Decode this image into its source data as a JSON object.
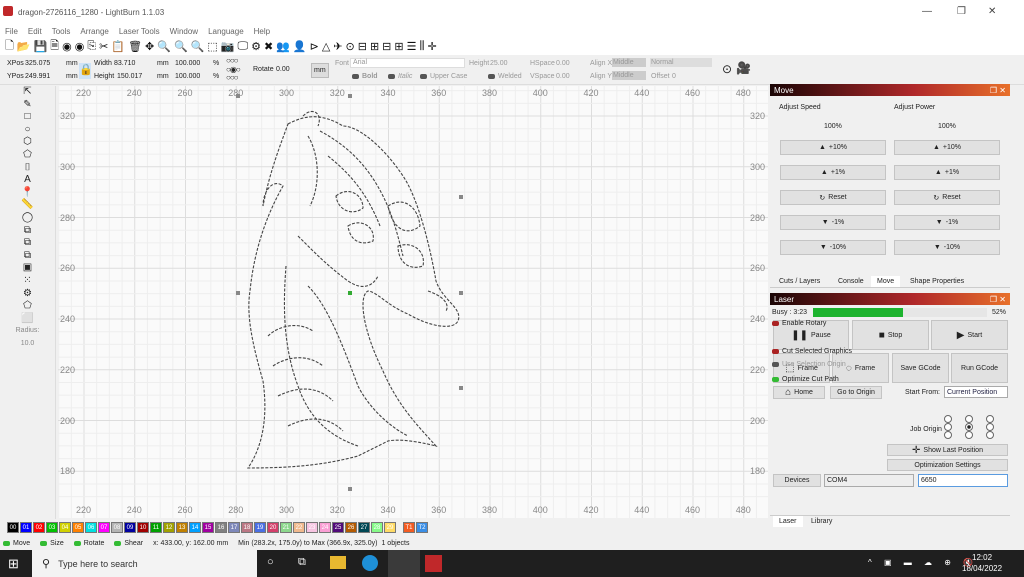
{
  "window": {
    "title": "dragon-2726116_1280 - LightBurn 1.1.03",
    "minimize": "—",
    "maximize": "❐",
    "close": "✕"
  },
  "menu": [
    "File",
    "Edit",
    "Tools",
    "Arrange",
    "Laser Tools",
    "Window",
    "Language",
    "Help"
  ],
  "toolbar_icons": [
    "new-file",
    "open-folder",
    "save",
    "save-as",
    "import",
    "export",
    "copy",
    "cut",
    "paste",
    "delete",
    "move",
    "zoom-in",
    "zoom-in-2",
    "zoom-out",
    "zoom-frame",
    "camera",
    "monitor",
    "settings",
    "tools",
    "group",
    "user",
    "mirror",
    "flip",
    "send",
    "target",
    "align-h",
    "align-v",
    "distribute-h",
    "distribute-v",
    "align-rows",
    "align-cols",
    "center"
  ],
  "props": {
    "xpos_label": "XPos",
    "xpos": "325.075",
    "ypos_label": "YPos",
    "ypos": "249.991",
    "unit": "mm",
    "width_label": "Width",
    "width": "83.710",
    "height_label": "Height",
    "height": "150.017",
    "scale_w": "100.000",
    "scale_h": "100.000",
    "pct": "%",
    "rotate_label": "Rotate",
    "rotate": "0.00",
    "mm_button": "mm",
    "font_label": "Font",
    "font": "Arial",
    "text_height_label": "Height",
    "text_height": "25.00",
    "hspace_label": "HSpace",
    "hspace": "0.00",
    "vspace_label": "VSpace",
    "vspace": "0.00",
    "alignx_label": "Align X",
    "alignx": "Middle",
    "aligny_label": "Align Y",
    "aligny": "Middle",
    "normal": "Normal",
    "offset_label": "Offset",
    "offset": "0",
    "bold": "Bold",
    "italic": "Italic",
    "upper": "Upper Case",
    "welded": "Welded"
  },
  "left_tools": {
    "icons": [
      "select",
      "pencil",
      "rectangle",
      "ellipse",
      "polygon",
      "polygon-2",
      "frame-tool",
      "text",
      "position-pin",
      "measure",
      "offset",
      "boolean-union",
      "boolean-subtract",
      "boolean-intersect",
      "boolean-weld",
      "array-grid",
      "array-circular",
      "corner-round",
      "corner-chamfer"
    ],
    "radius_label": "Radius:",
    "radius": "10.0"
  },
  "canvas": {
    "x_ticks": [
      "220",
      "240",
      "260",
      "280",
      "300",
      "320",
      "340",
      "360",
      "380",
      "400",
      "420",
      "440",
      "460",
      "480"
    ],
    "y_ticks": [
      "320",
      "300",
      "280",
      "260",
      "240",
      "220",
      "200",
      "180"
    ]
  },
  "move_panel": {
    "title": "Move",
    "speed_label": "Adjust Speed",
    "power_label": "Adjust Power",
    "speed_value": "100%",
    "power_value": "100%",
    "buttons": [
      "+10%",
      "+1%",
      "Reset",
      "-1%",
      "-10%"
    ]
  },
  "tabs_top": [
    "Cuts / Layers",
    "Console",
    "Move",
    "Shape Properties"
  ],
  "tabs_top_active": "Move",
  "laser_panel": {
    "title": "Laser",
    "busy": "Busy : 3:23",
    "progress_percent": 52,
    "progress_label": "52%",
    "progress_color": "#1db32e",
    "pause": "Pause",
    "stop": "Stop",
    "start": "Start",
    "frame1": "Frame",
    "frame2": "Frame",
    "save_gcode": "Save GCode",
    "run_gcode": "Run GCode",
    "home": "Home",
    "go_origin": "Go to Origin",
    "start_from_label": "Start From:",
    "start_from": "Current Position",
    "enable_rotary": "Enable Rotary",
    "cut_selected": "Cut Selected Graphics",
    "use_selection_origin": "Use Selection Origin",
    "optimize_cut": "Optimize Cut Path",
    "job_origin_label": "Job Origin",
    "show_last": "Show Last Position",
    "opt_settings": "Optimization Settings",
    "devices": "Devices",
    "port": "COM4",
    "device": "6650"
  },
  "tabs_bottom": [
    "Laser",
    "Library"
  ],
  "palette": [
    {
      "l": "00",
      "c": "#000000"
    },
    {
      "l": "01",
      "c": "#0000ff"
    },
    {
      "l": "02",
      "c": "#ff0000"
    },
    {
      "l": "03",
      "c": "#00c000"
    },
    {
      "l": "04",
      "c": "#d0d000"
    },
    {
      "l": "05",
      "c": "#ff8000"
    },
    {
      "l": "06",
      "c": "#00e0e0"
    },
    {
      "l": "07",
      "c": "#ff00ff"
    },
    {
      "l": "08",
      "c": "#b4b4b4"
    },
    {
      "l": "09",
      "c": "#0000a0"
    },
    {
      "l": "10",
      "c": "#a00000"
    },
    {
      "l": "11",
      "c": "#00a000"
    },
    {
      "l": "12",
      "c": "#a0a000"
    },
    {
      "l": "13",
      "c": "#c08000"
    },
    {
      "l": "14",
      "c": "#00a0ff"
    },
    {
      "l": "15",
      "c": "#a000a0"
    },
    {
      "l": "16",
      "c": "#808080"
    },
    {
      "l": "17",
      "c": "#7d87b9"
    },
    {
      "l": "18",
      "c": "#bb7784"
    },
    {
      "l": "19",
      "c": "#4a6fe3"
    },
    {
      "l": "20",
      "c": "#d33f6a"
    },
    {
      "l": "21",
      "c": "#8cd78c"
    },
    {
      "l": "22",
      "c": "#f0b98d"
    },
    {
      "l": "23",
      "c": "#f6c4e1"
    },
    {
      "l": "24",
      "c": "#fa9ed4"
    },
    {
      "l": "25",
      "c": "#500a78"
    },
    {
      "l": "26",
      "c": "#b45a00"
    },
    {
      "l": "27",
      "c": "#004754"
    },
    {
      "l": "28",
      "c": "#86fa88"
    },
    {
      "l": "29",
      "c": "#ffdb66"
    },
    {
      "l": "T1",
      "c": "#f35b21"
    },
    {
      "l": "T2",
      "c": "#3a8ee6"
    }
  ],
  "status": {
    "move": "Move",
    "size": "Size",
    "rotate": "Rotate",
    "shear": "Shear",
    "coords": "x: 433.00, y: 162.00 mm",
    "bounds": "Min (283.2x, 175.0y) to Max (366.9x, 325.0y)",
    "objects": "1 objects"
  },
  "taskbar": {
    "search_placeholder": "Type here to search",
    "time": "12:02",
    "date": "18/04/2022"
  }
}
